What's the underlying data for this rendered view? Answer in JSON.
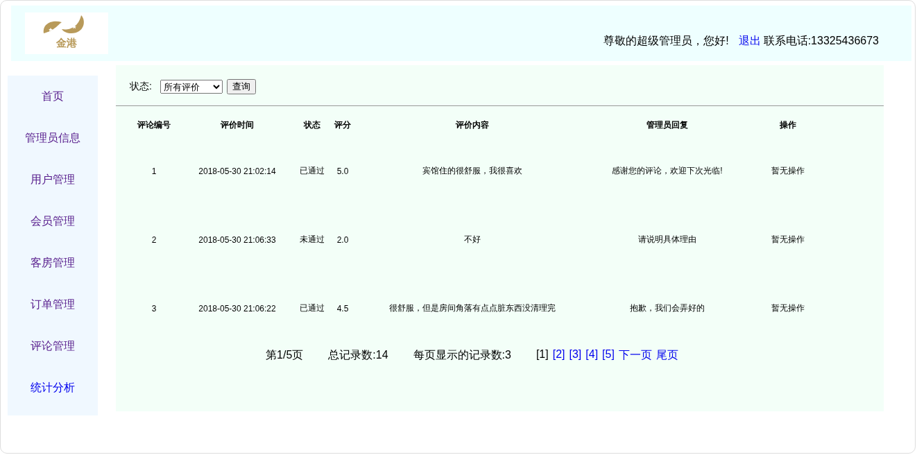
{
  "header": {
    "logo_text": "金港",
    "greeting": "尊敬的超级管理员，您好!",
    "logout": "退出",
    "phone": "联系电话:13325436673"
  },
  "sidebar": {
    "items": [
      {
        "label": "首页",
        "visited": true
      },
      {
        "label": "管理员信息",
        "visited": true
      },
      {
        "label": "用户管理",
        "visited": true
      },
      {
        "label": "会员管理",
        "visited": true
      },
      {
        "label": "客房管理",
        "visited": true
      },
      {
        "label": "订单管理",
        "visited": true
      },
      {
        "label": "评论管理",
        "visited": true
      },
      {
        "label": "统计分析",
        "visited": false
      }
    ]
  },
  "filter": {
    "label": "状态:",
    "select_value": "所有评价",
    "button": "查询"
  },
  "table": {
    "columns": [
      "评论编号",
      "评价时间",
      "状态",
      "评分",
      "评价内容",
      "管理员回复",
      "操作"
    ],
    "rows": [
      [
        "1",
        "2018-05-30 21:02:14",
        "已通过",
        "5.0",
        "宾馆住的很舒服，我很喜欢",
        "感谢您的评论，欢迎下次光临!",
        "暂无操作"
      ],
      [
        "2",
        "2018-05-30 21:06:33",
        "未通过",
        "2.0",
        "不好",
        "请说明具体理由",
        "暂无操作"
      ],
      [
        "3",
        "2018-05-30 21:06:22",
        "已通过",
        "4.5",
        "很舒服，但是房间角落有点点脏东西没清理完",
        "抱歉，我们会弄好的",
        "暂无操作"
      ]
    ]
  },
  "pagination": {
    "page": "第1/5页",
    "total": "总记录数:14",
    "per_page": "每页显示的记录数:3",
    "links": [
      {
        "label": "[1]",
        "current": true
      },
      {
        "label": "[2]",
        "current": false
      },
      {
        "label": "[3]",
        "current": false
      },
      {
        "label": "[4]",
        "current": false
      },
      {
        "label": "[5]",
        "current": false
      },
      {
        "label": "下一页",
        "current": false
      },
      {
        "label": "尾页",
        "current": false
      }
    ]
  }
}
